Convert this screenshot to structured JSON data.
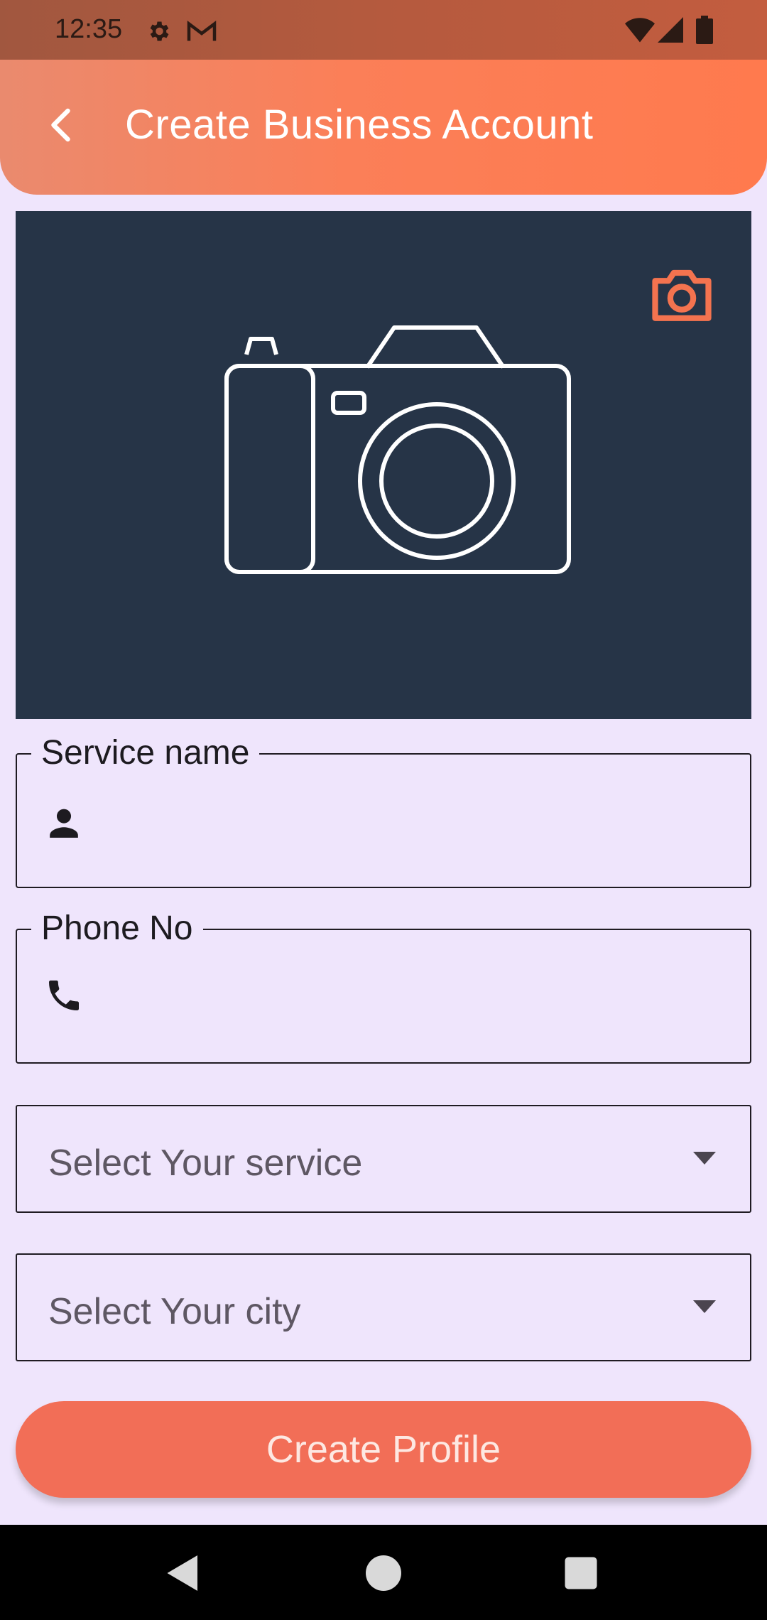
{
  "status_bar": {
    "time": "12:35",
    "icons": [
      "settings-icon",
      "gmail-icon",
      "wifi-icon",
      "signal-icon",
      "battery-icon"
    ]
  },
  "app_bar": {
    "title": "Create Business Account",
    "back_icon": "chevron-left-icon",
    "background": "#fb7f58"
  },
  "image_panel": {
    "background": "#263447",
    "change_photo_icon": "camera-icon",
    "placeholder_icon": "camera-icon"
  },
  "form": {
    "service_name": {
      "label": "Service name",
      "value": "",
      "icon": "person-icon"
    },
    "phone": {
      "label": "Phone No",
      "value": "",
      "icon": "phone-icon"
    },
    "service_select": {
      "selected": "Select Your service",
      "icon": "dropdown-arrow-icon"
    },
    "city_select": {
      "selected": "Select Your city",
      "icon": "dropdown-arrow-icon"
    }
  },
  "actions": {
    "create_label": "Create Profile",
    "accent": "#f26e57"
  },
  "nav_bar": {
    "buttons": [
      "back-triangle-icon",
      "home-circle-icon",
      "recents-square-icon"
    ]
  }
}
